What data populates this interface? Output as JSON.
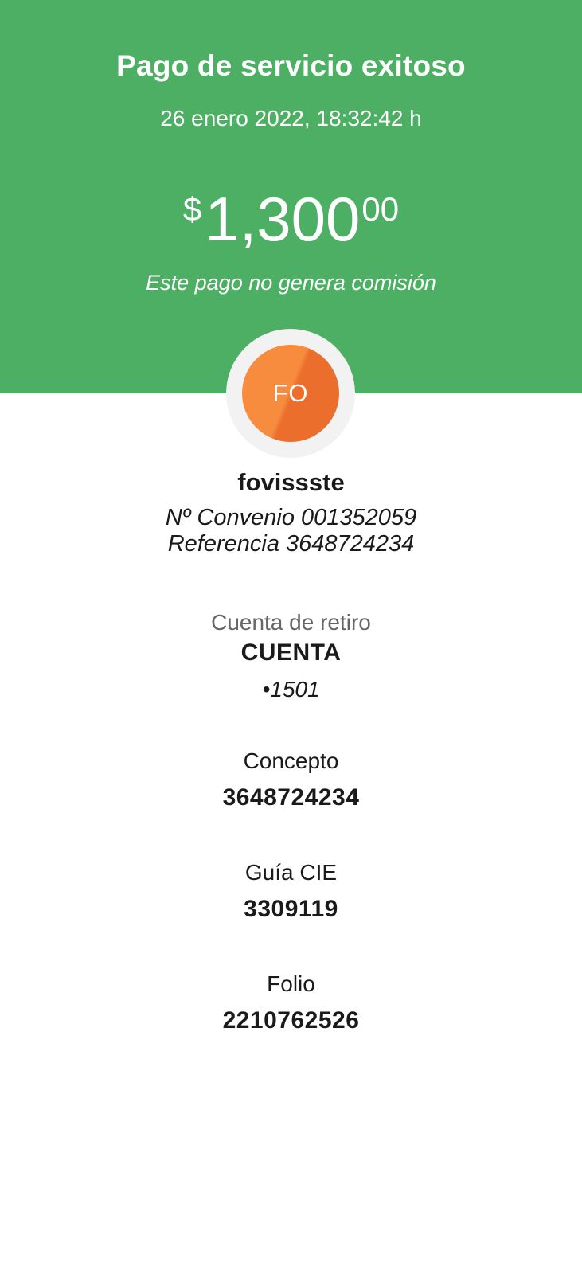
{
  "header": {
    "title": "Pago de servicio exitoso",
    "datetime": "26 enero 2022, 18:32:42 h",
    "amount": {
      "currency": "$",
      "integer": "1,300",
      "cents": "00"
    },
    "commission_note": "Este pago no genera comisión",
    "background_color": "#4caf64"
  },
  "biller": {
    "initials": "FO",
    "name": "fovissste",
    "agreement": "Nº Convenio 001352059",
    "reference": "Referencia 3648724234",
    "avatar_color": "#f78c3f"
  },
  "withdrawal_account": {
    "label": "Cuenta de retiro",
    "value": "CUENTA",
    "number": "•1501"
  },
  "concept": {
    "label": "Concepto",
    "value": "3648724234"
  },
  "cie_guide": {
    "label": "Guía CIE",
    "value": "3309119"
  },
  "folio": {
    "label": "Folio",
    "value": "2210762526"
  }
}
